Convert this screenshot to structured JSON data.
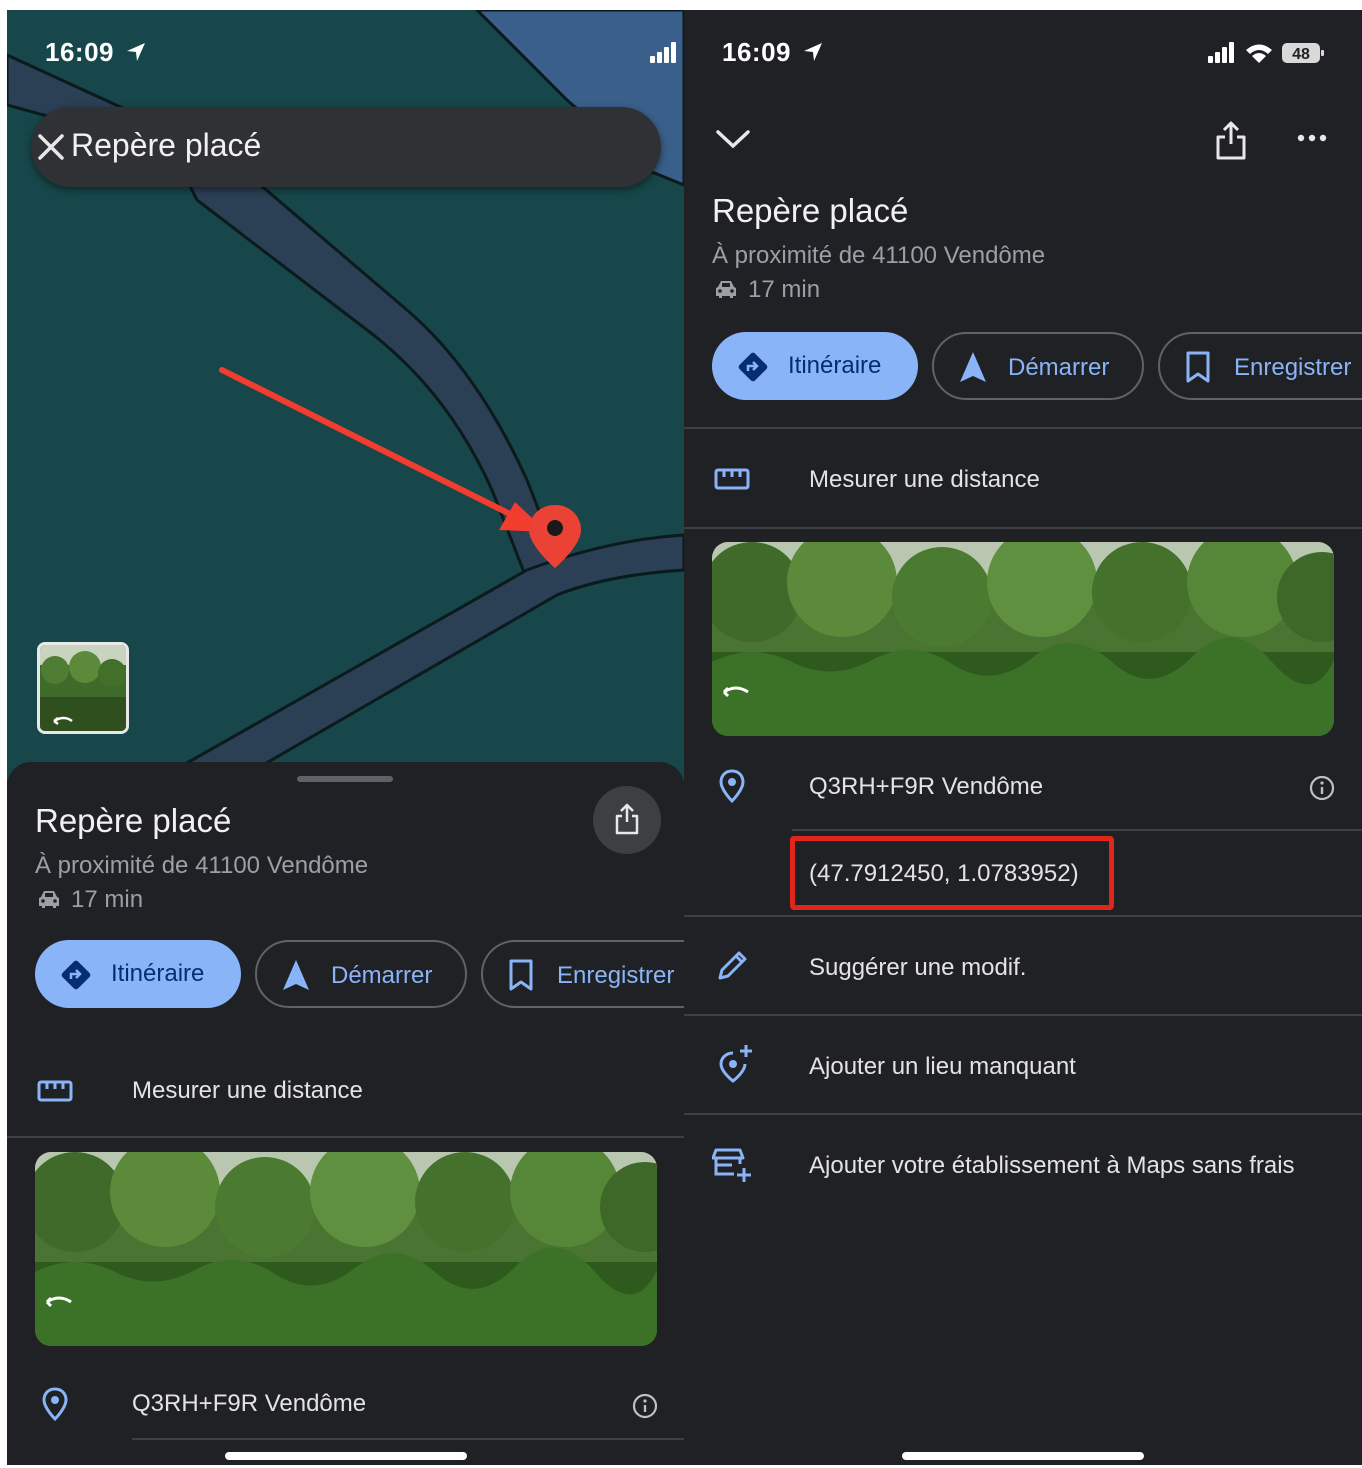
{
  "status": {
    "time": "16:09",
    "battery": "48"
  },
  "left": {
    "search_text": "Repère placé",
    "sheet": {
      "title": "Repère placé",
      "subtitle": "À proximité de 41100 Vendôme",
      "travel_time": "17 min",
      "chips": {
        "itineraire": "Itinéraire",
        "demarrer": "Démarrer",
        "enregistrer": "Enregistrer"
      },
      "measure": "Mesurer une distance",
      "plus_code": "Q3RH+F9R Vendôme"
    }
  },
  "right": {
    "title": "Repère placé",
    "subtitle": "À proximité de 41100 Vendôme",
    "travel_time": "17 min",
    "chips": {
      "itineraire": "Itinéraire",
      "demarrer": "Démarrer",
      "enregistrer": "Enregistrer"
    },
    "measure": "Mesurer une distance",
    "plus_code": "Q3RH+F9R Vendôme",
    "coordinates": "(47.7912450, 1.0783952)",
    "suggest": "Suggérer une modif.",
    "add_place": "Ajouter un lieu manquant",
    "add_business": "Ajouter votre établissement à Maps sans frais"
  },
  "colors": {
    "map_background": "#17474a",
    "road": "#2b3f55",
    "accent_blue": "#8ab4f8",
    "pin_red": "#ea4335",
    "arrow_red": "#f23c2d",
    "highlight_red": "#e1251b"
  }
}
